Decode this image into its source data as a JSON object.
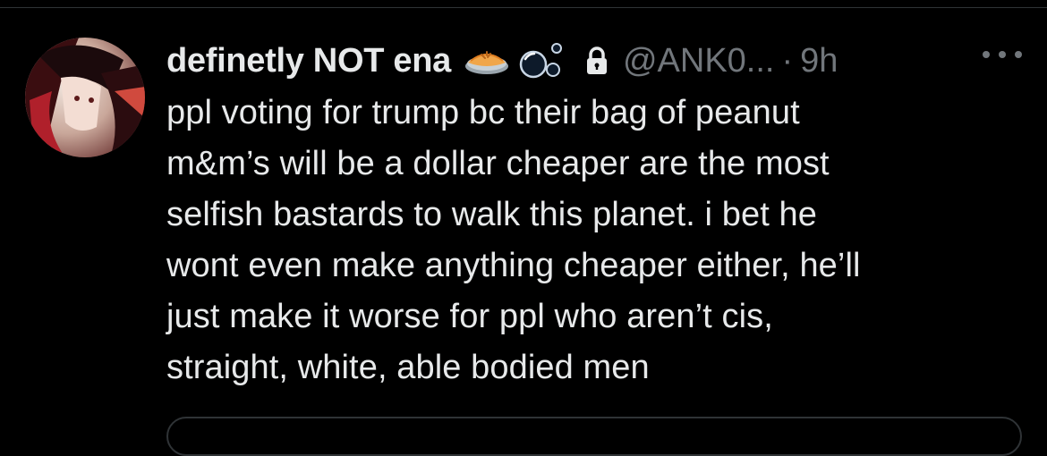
{
  "tweet": {
    "display_name": "definetly NOT ena",
    "handle": "@ANK0...",
    "separator": "·",
    "time": "9h",
    "body": "ppl voting for trump bc their bag of peanut\nm&m’s will be a dollar cheaper are the most\nselfish bastards to walk this planet. i bet he\nwont even make anything cheaper either, he’ll\njust make it worse for ppl who aren’t cis,\nstraight, white, able bodied men",
    "name_emojis": [
      "pie-emoji",
      "bubbles-emoji"
    ],
    "protected_icon": "lock-icon",
    "more_icon": "more-options-icon"
  },
  "colors": {
    "background": "#000000",
    "text_primary": "#e7e9ea",
    "text_secondary": "#71767b",
    "divider": "#2f3336"
  }
}
